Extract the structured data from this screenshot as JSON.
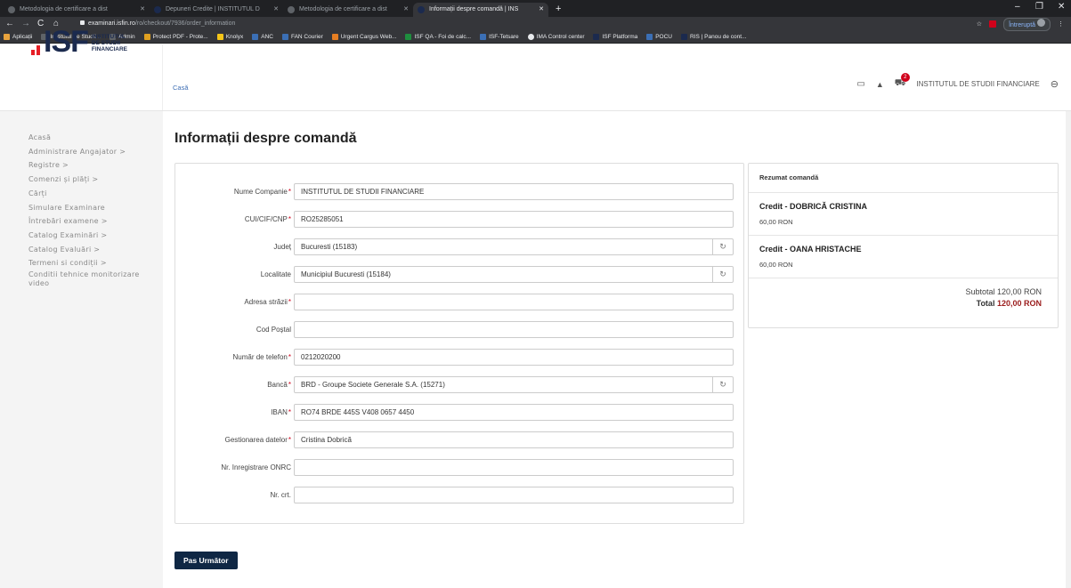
{
  "browser": {
    "tabs": [
      {
        "title": "Metodologia de certificare a dist",
        "active": false
      },
      {
        "title": "Depuneri Credite | INSTITUTUL D",
        "active": false
      },
      {
        "title": "Metodologia de certificare a dist",
        "active": false
      },
      {
        "title": "Informații despre comandă | INS",
        "active": true
      }
    ],
    "url_host": "examinari.isfin.ro",
    "url_path": "/ro/checkout/7936/order_information",
    "paused_label": "Întreruptă",
    "bookmarks": [
      "Aplicații",
      "Institutul de Studii...",
      "Admin",
      "Protect PDF - Prote...",
      "Knolyx",
      "ANC",
      "FAN Courier",
      "Urgent Cargus Web...",
      "ISF QA - Foi de calc...",
      "ISF-Tetsare",
      "IMA Control center",
      "ISF Platforma",
      "POCU",
      "RIS | Panou de cont..."
    ]
  },
  "logo": {
    "word": "ISF",
    "sub1": "INSTITUTUL",
    "sub2": "DE STUDII",
    "sub3": "FINANCIARE"
  },
  "header": {
    "breadcrumb": "Casă",
    "cart_count": "2",
    "org_name": "INSTITUTUL DE STUDII FINANCIARE"
  },
  "sidebar": {
    "items": [
      "Acasă",
      "Administrare Angajator >",
      "Registre >",
      "Comenzi și plăți >",
      "Cărți",
      "Simulare Examinare",
      "Întrebări examene >",
      "Catalog Examinări >",
      "Catalog Evaluări >",
      "Termeni si condiții >",
      "Conditii tehnice monitorizare",
      "video"
    ]
  },
  "page": {
    "title": "Informații despre comandă"
  },
  "form": {
    "fields": [
      {
        "label": "Nume Companie",
        "required": true,
        "value": "INSTITUTUL DE STUDII FINANCIARE",
        "select": false
      },
      {
        "label": "CUI/CIF/CNP",
        "required": true,
        "value": "RO25285051",
        "select": false
      },
      {
        "label": "Județ",
        "required": false,
        "value": "Bucuresti (15183)",
        "select": true
      },
      {
        "label": "Localitate",
        "required": false,
        "value": "Municipiul Bucuresti (15184)",
        "select": true
      },
      {
        "label": "Adresa străzii",
        "required": true,
        "value": "",
        "select": false
      },
      {
        "label": "Cod Poștal",
        "required": false,
        "value": "",
        "select": false
      },
      {
        "label": "Număr de telefon",
        "required": true,
        "value": "0212020200",
        "select": false
      },
      {
        "label": "Bancă",
        "required": true,
        "value": "BRD - Groupe Societe Generale S.A. (15271)",
        "select": true
      },
      {
        "label": "IBAN",
        "required": true,
        "value": "RO74 BRDE 445S V408 0657 4450",
        "select": false
      },
      {
        "label": "Gestionarea datelor",
        "required": true,
        "value": "Cristina Dobrică",
        "select": false
      },
      {
        "label": "Nr. Inregistrare ONRC",
        "required": false,
        "value": "",
        "select": false
      },
      {
        "label": "Nr. crt.",
        "required": false,
        "value": "",
        "select": false
      }
    ]
  },
  "summary": {
    "heading": "Rezumat comandă",
    "items": [
      {
        "name": "Credit - DOBRICĂ CRISTINA",
        "price": "60,00 RON"
      },
      {
        "name": "Credit - OANA HRISTACHE",
        "price": "60,00 RON"
      }
    ],
    "subtotal_label": "Subtotal 120,00 RON",
    "total_label": "Total",
    "total_value": "120,00 RON"
  },
  "actions": {
    "next_label": "Pas Următor"
  }
}
